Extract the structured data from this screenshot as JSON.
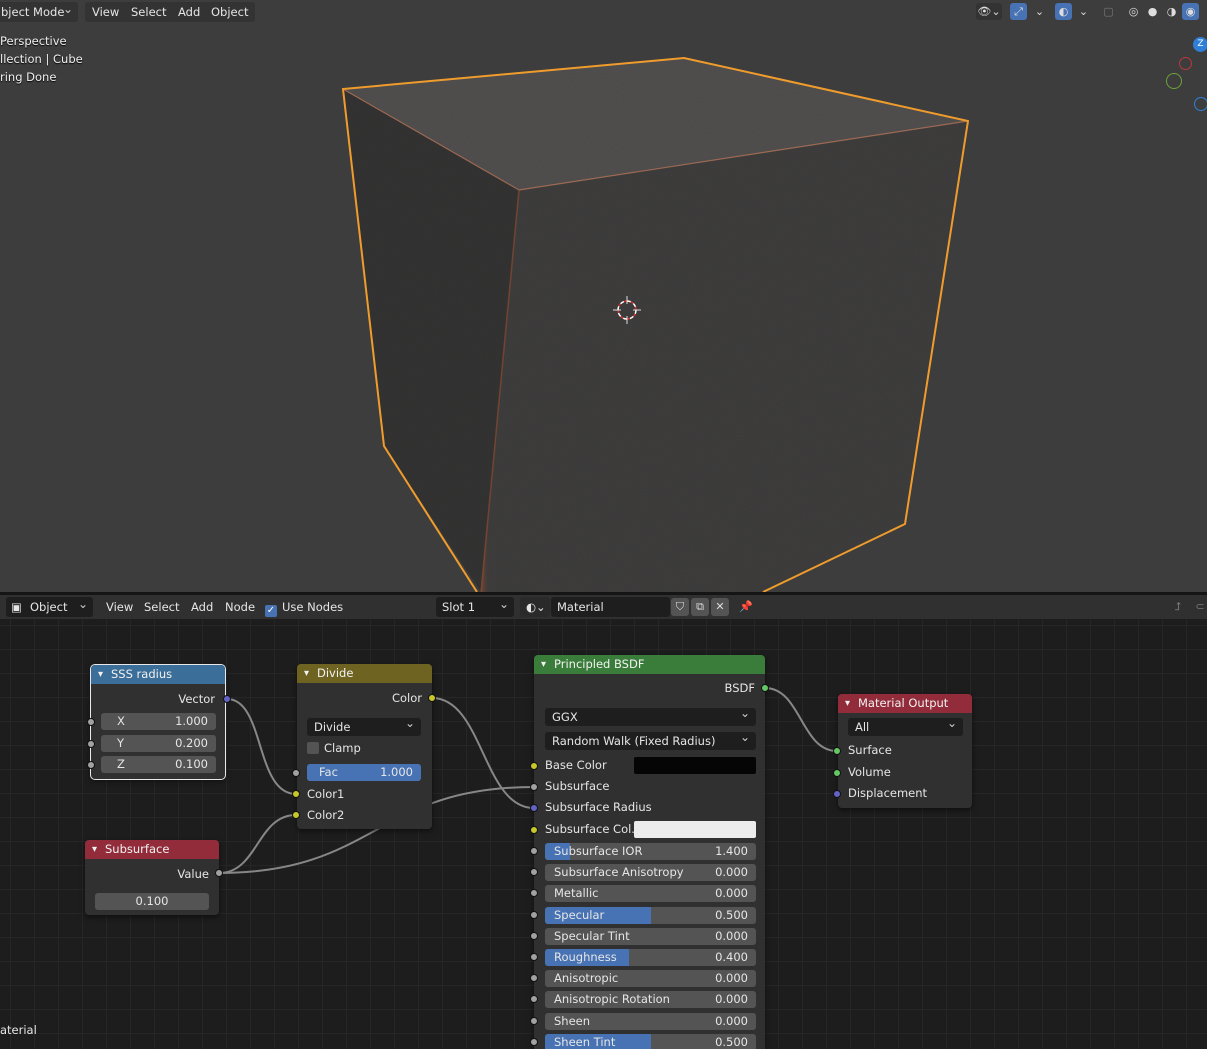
{
  "viewport": {
    "mode_label": "bject Mode",
    "menu": [
      "View",
      "Select",
      "Add",
      "Object"
    ],
    "overlay": [
      "Perspective",
      "llection | Cube",
      "ring Done"
    ],
    "gizmo_axis": "Z",
    "colors": {
      "selection_outline": "#f09c2c",
      "background": "#3d3d3d"
    }
  },
  "node_header": {
    "editor_type": "Object",
    "menu": [
      "View",
      "Select",
      "Add",
      "Node"
    ],
    "use_nodes_label": "Use Nodes",
    "use_nodes_checked": true,
    "slot": "Slot 1",
    "material": "Material"
  },
  "nodes": {
    "sss_radius": {
      "title": "SSS radius",
      "output": "Vector",
      "fields": [
        {
          "label": "X",
          "value": "1.000"
        },
        {
          "label": "Y",
          "value": "0.200"
        },
        {
          "label": "Z",
          "value": "0.100"
        }
      ]
    },
    "divide": {
      "title": "Divide",
      "output": "Color",
      "operation": "Divide",
      "clamp_label": "Clamp",
      "fac_label": "Fac",
      "fac_value": "1.000",
      "inputs": [
        "Color1",
        "Color2"
      ]
    },
    "subsurface": {
      "title": "Subsurface",
      "output": "Value",
      "value": "0.100"
    },
    "principled": {
      "title": "Principled BSDF",
      "output": "BSDF",
      "distribution": "GGX",
      "subsurface_method": "Random Walk (Fixed Radius)",
      "base_color_label": "Base Color",
      "subsurface_label": "Subsurface",
      "subsurface_radius_label": "Subsurface Radius",
      "subsurface_color_label": "Subsurface Col...",
      "sliders": [
        {
          "label": "Subsurface IOR",
          "value": "1.400",
          "fill": 0.12
        },
        {
          "label": "Subsurface Anisotropy",
          "value": "0.000",
          "fill": 0
        },
        {
          "label": "Metallic",
          "value": "0.000",
          "fill": 0
        },
        {
          "label": "Specular",
          "value": "0.500",
          "fill": 0.5
        },
        {
          "label": "Specular Tint",
          "value": "0.000",
          "fill": 0
        },
        {
          "label": "Roughness",
          "value": "0.400",
          "fill": 0.4
        },
        {
          "label": "Anisotropic",
          "value": "0.000",
          "fill": 0
        },
        {
          "label": "Anisotropic Rotation",
          "value": "0.000",
          "fill": 0
        },
        {
          "label": "Sheen",
          "value": "0.000",
          "fill": 0
        },
        {
          "label": "Sheen Tint",
          "value": "0.500",
          "fill": 0.5
        }
      ],
      "colors": {
        "base_color": "#050505",
        "subsurface_color": "#ececec"
      }
    },
    "material_output": {
      "title": "Material Output",
      "target": "All",
      "inputs": [
        "Surface",
        "Volume",
        "Displacement"
      ]
    }
  },
  "footer_label": "aterial"
}
